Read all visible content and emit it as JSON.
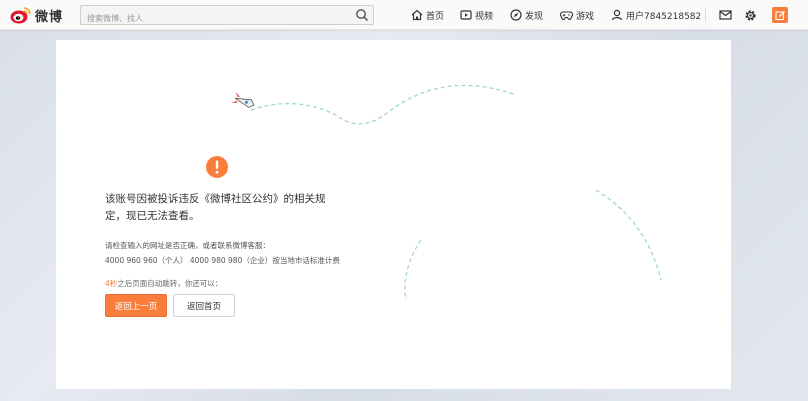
{
  "header": {
    "logo_text": "微博",
    "search_placeholder": "搜索微博、找人",
    "nav": {
      "home": "首页",
      "video": "视频",
      "discover": "发现",
      "game": "游戏",
      "user": "用户7845218582"
    }
  },
  "error": {
    "message": "该账号因被投诉违反《微博社区公约》的相关规定，现已无法查看。",
    "hint_line1": "请检查输入的网址是否正确，或者联系微博客服：",
    "hint_line2": "4000 960 960（个人） 4000 980 980（企业）按当地市话标准计费",
    "redirect_seconds": "4秒",
    "redirect_rest": "之后页面自动跳转，你还可以：",
    "back_button": "返回上一页",
    "home_button": "返回首页"
  },
  "colors": {
    "accent": "#fa7d3c",
    "page_bg": "#dde2e9"
  },
  "icons": [
    "weibo-logo-icon",
    "search-icon",
    "home-icon",
    "video-icon",
    "discover-icon",
    "game-icon",
    "user-icon",
    "message-icon",
    "settings-icon",
    "compose-icon",
    "warning-icon"
  ]
}
